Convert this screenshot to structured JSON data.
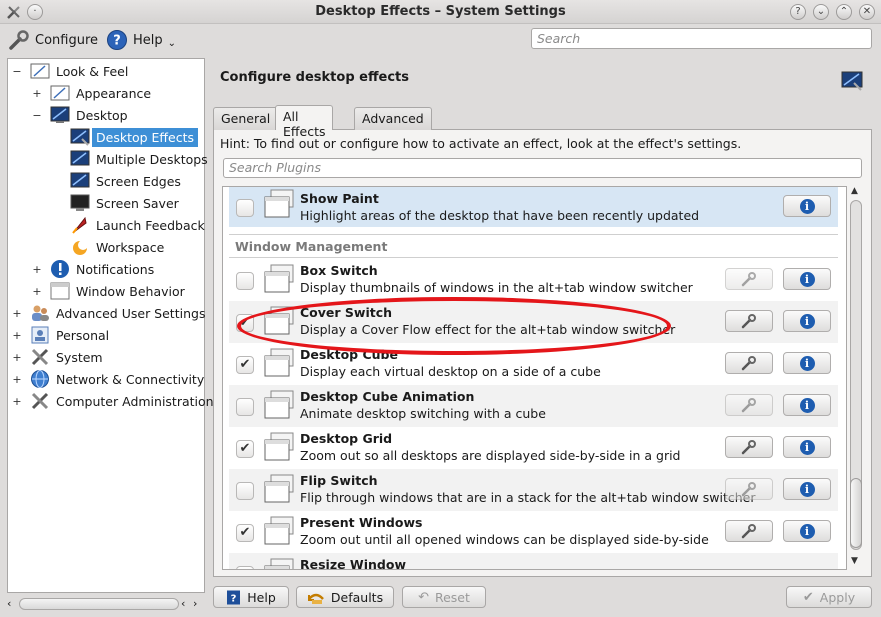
{
  "window": {
    "title": "Desktop Effects – System Settings",
    "controls": [
      "?",
      "⌄",
      "⌃",
      "✕"
    ]
  },
  "toolbar": {
    "configure_label": "Configure",
    "help_label": "Help",
    "search_placeholder": "Search"
  },
  "sidebar": {
    "items": [
      {
        "label": "Look & Feel",
        "icon": "look-feel-icon",
        "expander": "−"
      },
      {
        "label": "Appearance",
        "icon": "appearance-icon",
        "expander": "+"
      },
      {
        "label": "Desktop",
        "icon": "desktop-icon",
        "expander": "−"
      },
      {
        "label": "Desktop Effects",
        "icon": "desktop-effects-icon",
        "expander": ""
      },
      {
        "label": "Multiple Desktops",
        "icon": "multiple-desktops-icon",
        "expander": ""
      },
      {
        "label": "Screen Edges",
        "icon": "screen-edges-icon",
        "expander": ""
      },
      {
        "label": "Screen Saver",
        "icon": "screen-saver-icon",
        "expander": ""
      },
      {
        "label": "Launch Feedback",
        "icon": "launch-feedback-icon",
        "expander": ""
      },
      {
        "label": "Workspace",
        "icon": "workspace-icon",
        "expander": ""
      },
      {
        "label": "Notifications",
        "icon": "notifications-icon",
        "expander": "+"
      },
      {
        "label": "Window Behavior",
        "icon": "window-behavior-icon",
        "expander": "+"
      },
      {
        "label": "Advanced User Settings",
        "icon": "advanced-user-icon",
        "expander": "+"
      },
      {
        "label": "Personal",
        "icon": "personal-icon",
        "expander": "+"
      },
      {
        "label": "System",
        "icon": "system-icon",
        "expander": "+"
      },
      {
        "label": "Network & Connectivity",
        "icon": "network-icon",
        "expander": "+"
      },
      {
        "label": "Computer Administration",
        "icon": "computer-admin-icon",
        "expander": "+"
      }
    ]
  },
  "main": {
    "title": "Configure desktop effects",
    "tabs": [
      {
        "label": "General"
      },
      {
        "label": "All Effects"
      },
      {
        "label": "Advanced"
      }
    ],
    "hint": "Hint: To find out or configure how to activate an effect, look at the effect's settings.",
    "plugin_search_placeholder": "Search Plugins",
    "category_label": "Window Management",
    "top_plugin": {
      "name": "Show Paint",
      "desc": "Highlight areas of the desktop that have been recently updated",
      "checked": false
    },
    "plugins": [
      {
        "name": "Box Switch",
        "desc": "Display thumbnails of windows in the alt+tab window switcher",
        "checked": false
      },
      {
        "name": "Cover Switch",
        "desc": "Display a Cover Flow effect for the alt+tab window switcher",
        "checked": true
      },
      {
        "name": "Desktop Cube",
        "desc": "Display each virtual desktop on a side of a cube",
        "checked": true
      },
      {
        "name": "Desktop Cube Animation",
        "desc": "Animate desktop switching with a cube",
        "checked": false
      },
      {
        "name": "Desktop Grid",
        "desc": "Zoom out so all desktops are displayed side-by-side in a grid",
        "checked": true
      },
      {
        "name": "Flip Switch",
        "desc": "Flip through windows that are in a stack for the alt+tab window switcher",
        "checked": false
      },
      {
        "name": "Present Windows",
        "desc": "Zoom out until all opened windows can be displayed side-by-side",
        "checked": true
      },
      {
        "name": "Resize Window",
        "desc": "",
        "checked": false
      }
    ]
  },
  "footer": {
    "help_label": "Help",
    "defaults_label": "Defaults",
    "reset_label": "Reset",
    "apply_label": "Apply"
  },
  "colors": {
    "selection": "#3d8fd6",
    "annotation": "#e4161a",
    "info_blue": "#1e5db0"
  }
}
